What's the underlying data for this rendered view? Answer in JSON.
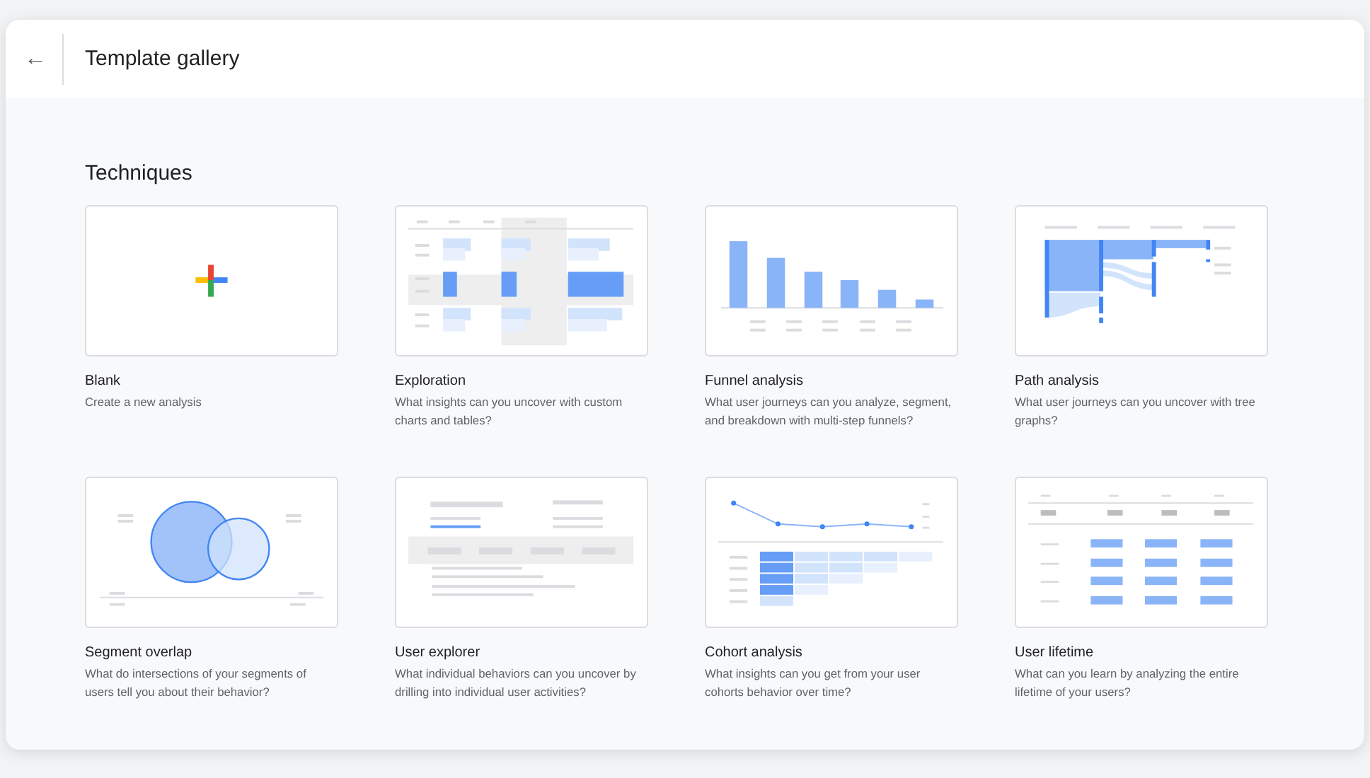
{
  "header": {
    "back_icon": "←",
    "title": "Template gallery"
  },
  "section": {
    "title": "Techniques"
  },
  "templates": [
    {
      "kind": "blank",
      "title": "Blank",
      "description": "Create a new analysis"
    },
    {
      "kind": "exploration",
      "title": "Exploration",
      "description": "What insights can you uncover with custom charts and tables?"
    },
    {
      "kind": "funnel",
      "title": "Funnel analysis",
      "description": "What user journeys can you analyze, segment, and breakdown with multi-step funnels?"
    },
    {
      "kind": "path",
      "title": "Path analysis",
      "description": "What user journeys can you uncover with tree graphs?"
    },
    {
      "kind": "segment",
      "title": "Segment overlap",
      "description": "What do intersections of your segments of users tell you about their behavior?"
    },
    {
      "kind": "explorer",
      "title": "User explorer",
      "description": "What individual behaviors can you uncover by drilling into individual user activities?"
    },
    {
      "kind": "cohort",
      "title": "Cohort analysis",
      "description": "What insights can you get from your user cohorts behavior over time?"
    },
    {
      "kind": "lifetime",
      "title": "User lifetime",
      "description": "What can you learn by analyzing the entire lifetime of your users?"
    }
  ]
}
